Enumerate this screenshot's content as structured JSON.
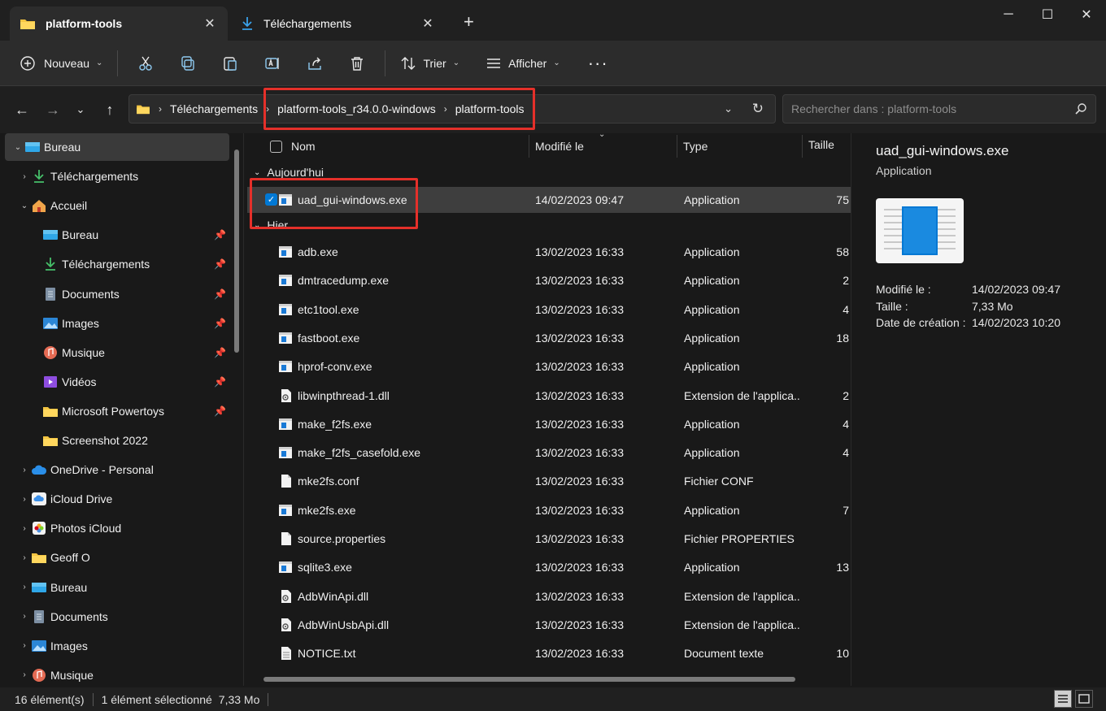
{
  "tabs": [
    {
      "label": "platform-tools",
      "icon": "folder-icon",
      "active": true
    },
    {
      "label": "Téléchargements",
      "icon": "download-icon",
      "active": false
    }
  ],
  "toolbar": {
    "new_label": "Nouveau",
    "sort_label": "Trier",
    "view_label": "Afficher"
  },
  "address": {
    "crumbs": [
      "Téléchargements",
      "platform-tools_r34.0.0-windows",
      "platform-tools"
    ]
  },
  "search": {
    "placeholder": "Rechercher dans : platform-tools"
  },
  "sidebar": {
    "items": [
      {
        "label": "Bureau",
        "icon": "desktop-icon",
        "level": 0,
        "expand": "open",
        "selected": true
      },
      {
        "label": "Téléchargements",
        "icon": "download-icon",
        "level": 1,
        "expand": "closed"
      },
      {
        "label": "Accueil",
        "icon": "home-icon",
        "level": 1,
        "expand": "open"
      },
      {
        "label": "Bureau",
        "icon": "desktop-icon",
        "level": 2,
        "pinned": true
      },
      {
        "label": "Téléchargements",
        "icon": "download-icon",
        "level": 2,
        "pinned": true
      },
      {
        "label": "Documents",
        "icon": "document-icon",
        "level": 2,
        "pinned": true
      },
      {
        "label": "Images",
        "icon": "image-icon",
        "level": 2,
        "pinned": true
      },
      {
        "label": "Musique",
        "icon": "music-icon",
        "level": 2,
        "pinned": true
      },
      {
        "label": "Vidéos",
        "icon": "video-icon",
        "level": 2,
        "pinned": true
      },
      {
        "label": "Microsoft Powertoys",
        "icon": "folder-icon",
        "level": 2,
        "pinned": true
      },
      {
        "label": "Screenshot 2022",
        "icon": "folder-icon",
        "level": 2
      },
      {
        "label": "OneDrive - Personal",
        "icon": "cloud-icon",
        "level": 1,
        "expand": "closed"
      },
      {
        "label": "iCloud Drive",
        "icon": "icloud-icon",
        "level": 1,
        "expand": "closed"
      },
      {
        "label": "Photos iCloud",
        "icon": "photos-icon",
        "level": 1,
        "expand": "closed"
      },
      {
        "label": "Geoff O",
        "icon": "folder-icon",
        "level": 1,
        "expand": "closed"
      },
      {
        "label": "Bureau",
        "icon": "desktop-icon",
        "level": 1,
        "expand": "closed"
      },
      {
        "label": "Documents",
        "icon": "document-icon",
        "level": 1,
        "expand": "closed"
      },
      {
        "label": "Images",
        "icon": "image-icon",
        "level": 1,
        "expand": "closed"
      },
      {
        "label": "Musique",
        "icon": "music-icon",
        "level": 1,
        "expand": "closed"
      }
    ]
  },
  "columns": {
    "name": "Nom",
    "modified": "Modifié le",
    "type": "Type",
    "size": "Taille"
  },
  "groups": {
    "today": "Aujourd'hui",
    "yesterday": "Hier"
  },
  "files_today": [
    {
      "name": "uad_gui-windows.exe",
      "date": "14/02/2023 09:47",
      "type": "Application",
      "size": "7 5",
      "icon": "exe",
      "selected": true
    }
  ],
  "files_yesterday": [
    {
      "name": "adb.exe",
      "date": "13/02/2023 16:33",
      "type": "Application",
      "size": "5 8",
      "icon": "exe"
    },
    {
      "name": "dmtracedump.exe",
      "date": "13/02/2023 16:33",
      "type": "Application",
      "size": "2",
      "icon": "exe"
    },
    {
      "name": "etc1tool.exe",
      "date": "13/02/2023 16:33",
      "type": "Application",
      "size": "4",
      "icon": "exe"
    },
    {
      "name": "fastboot.exe",
      "date": "13/02/2023 16:33",
      "type": "Application",
      "size": "1 8",
      "icon": "exe"
    },
    {
      "name": "hprof-conv.exe",
      "date": "13/02/2023 16:33",
      "type": "Application",
      "size": "",
      "icon": "exe"
    },
    {
      "name": "libwinpthread-1.dll",
      "date": "13/02/2023 16:33",
      "type": "Extension de l'applica...",
      "size": "2",
      "icon": "dll"
    },
    {
      "name": "make_f2fs.exe",
      "date": "13/02/2023 16:33",
      "type": "Application",
      "size": "4",
      "icon": "exe"
    },
    {
      "name": "make_f2fs_casefold.exe",
      "date": "13/02/2023 16:33",
      "type": "Application",
      "size": "4",
      "icon": "exe"
    },
    {
      "name": "mke2fs.conf",
      "date": "13/02/2023 16:33",
      "type": "Fichier CONF",
      "size": "",
      "icon": "file"
    },
    {
      "name": "mke2fs.exe",
      "date": "13/02/2023 16:33",
      "type": "Application",
      "size": "7",
      "icon": "exe"
    },
    {
      "name": "source.properties",
      "date": "13/02/2023 16:33",
      "type": "Fichier PROPERTIES",
      "size": "",
      "icon": "file"
    },
    {
      "name": "sqlite3.exe",
      "date": "13/02/2023 16:33",
      "type": "Application",
      "size": "1 3",
      "icon": "exe"
    },
    {
      "name": "AdbWinApi.dll",
      "date": "13/02/2023 16:33",
      "type": "Extension de l'applica...",
      "size": "",
      "icon": "dll"
    },
    {
      "name": "AdbWinUsbApi.dll",
      "date": "13/02/2023 16:33",
      "type": "Extension de l'applica...",
      "size": "",
      "icon": "dll"
    },
    {
      "name": "NOTICE.txt",
      "date": "13/02/2023 16:33",
      "type": "Document texte",
      "size": "1 0",
      "icon": "txt"
    }
  ],
  "details": {
    "title": "uad_gui-windows.exe",
    "subtitle": "Application",
    "props": [
      {
        "label": "Modifié le :",
        "value": "14/02/2023 09:47"
      },
      {
        "label": "Taille :",
        "value": "7,33 Mo"
      },
      {
        "label": "Date de création :",
        "value": "14/02/2023 10:20"
      }
    ]
  },
  "status": {
    "count": "16 élément(s)",
    "selection": "1 élément sélectionné",
    "size": "7,33 Mo"
  },
  "colors": {
    "accent": "#0078d4",
    "highlight_box": "#e5302a",
    "folder": "#f4c542"
  }
}
